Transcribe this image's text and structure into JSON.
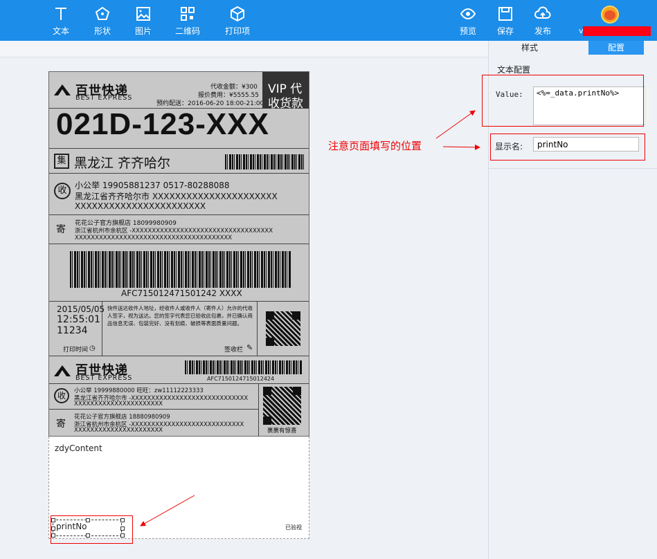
{
  "toolbar": {
    "left_tools": [
      {
        "label": "文本",
        "icon": "text-icon"
      },
      {
        "label": "形状",
        "icon": "shape-icon"
      },
      {
        "label": "图片",
        "icon": "image-icon"
      },
      {
        "label": "二维码",
        "icon": "qrcode-icon"
      },
      {
        "label": "打印项",
        "icon": "print-item-icon"
      }
    ],
    "right_tools": [
      {
        "label": "预览",
        "icon": "eye-icon"
      },
      {
        "label": "保存",
        "icon": "save-icon"
      },
      {
        "label": "发布",
        "icon": "upload-cloud-icon"
      }
    ],
    "user_prefix": "v"
  },
  "label": {
    "brand_cn": "百世快递",
    "brand_en": "BEST EXPRESS",
    "cod_amount": "代收金额：¥300",
    "fee": "报价费用：¥5555.55",
    "appointment": "预约配送：2016-06-20 18:00-21:00",
    "vip_line1": "VIP 代",
    "vip_line2": "收货款",
    "big_code": "021D-123-XXX",
    "dest_tag": "集",
    "destination": "黑龙江  齐齐哈尔",
    "recv_tag": "收",
    "recv_line1": "小公举    19905881237    0517-80288088",
    "recv_line2": "黑龙江省齐齐哈尔市 XXXXXXXXXXXXXXXXXXXXXX",
    "recv_line3": "XXXXXXXXXXXXXXXXXXXXXXX",
    "send_tag": "寄",
    "send_line1": "花花公子官方旗舰店    18099980909",
    "send_line2": "浙江省杭州市余杭区 -XXXXXXXXXXXXXXXXXXXXXXXXXXXXXXXXXXX",
    "send_line3": "XXXXXXXXXXXXXXXXXXXXXXXXXXXXXXXXXXXXXXX",
    "tracking": "AFC715012471501242 XXXX",
    "date": "2015/05/05",
    "time": "12:55:01",
    "num": "11234",
    "print_time": "打印时间",
    "terms": "快件送达收件人地址，经收件人或收件人（寄件人）允许的代收人签字，视为送达。您的签字代表您已验收此包裹，并已确认商品信息无误、包装完好、没有划痕、破损等表面质量问题。",
    "sign_field": "签收栏",
    "tracking2": "AFC7150124715012424",
    "recv2_line1": "小公举    19999880000    旺旺：zw11112223333",
    "recv2_line2": "黑龙江省齐齐哈尔市 -XXXXXXXXXXXXXXXXXXXXXXXXXXXXX",
    "recv2_line3": "XXXXXXXXXXXXXXXXXXXXXX",
    "send2_line1": "花花公子官方旗舰店    18880980909",
    "send2_line2": "浙江省杭州市余杭区 -XXXXXXXXXXXXXXXXXXXXXXXXXXXX",
    "send2_line3": "XXXXXXXXXXXXXXXXXXXXXX",
    "gift_note": "裹裹有惊喜"
  },
  "custom": {
    "zdy_content": "zdyContent",
    "print_no": "printNo",
    "signed": "已验视"
  },
  "panel": {
    "tab_style": "样式",
    "tab_config": "配置",
    "section_title": "文本配置",
    "value_label": "Value:",
    "value_text": "<%=_data.printNo%>",
    "name_label": "显示名:",
    "name_value": "printNo"
  },
  "annotation": "注意页面填写的位置",
  "colors": {
    "accent": "#1c8de8",
    "tab_active": "#2996f2",
    "highlight": "#e00000"
  }
}
